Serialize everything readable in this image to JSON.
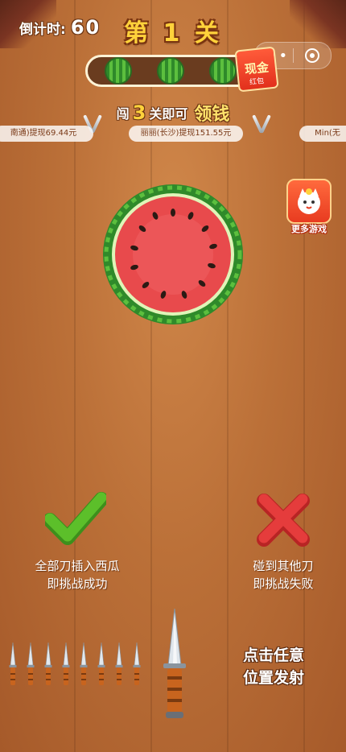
{
  "hud": {
    "countdown_label": "倒计时:",
    "countdown_value": "60",
    "level_title": "第 1 关"
  },
  "progress": {
    "total_levels": 3,
    "cash_badge_main": "现金",
    "cash_badge_sub": "红包"
  },
  "goal": {
    "prefix": "闯",
    "number": "3",
    "middle": "关即可",
    "reward": "领钱"
  },
  "ticker": [
    "南通)提现69.44元",
    "丽丽(长沙)提现151.55元",
    "Min(无"
  ],
  "side": {
    "more_games_label": "更多游戏"
  },
  "rules": {
    "win_line1": "全部刀插入西瓜",
    "win_line2": "即挑战成功",
    "lose_line1": "碰到其他刀",
    "lose_line2": "即挑战失败"
  },
  "knives": {
    "remaining": 8
  },
  "hint": {
    "line1": "点击任意",
    "line2": "位置发射"
  },
  "colors": {
    "level_title": "#ffd23b",
    "melon_flesh": "#e84a4c",
    "melon_rind": "#3fa52f",
    "check": "#5cbf2a",
    "cross": "#e53c3c"
  }
}
